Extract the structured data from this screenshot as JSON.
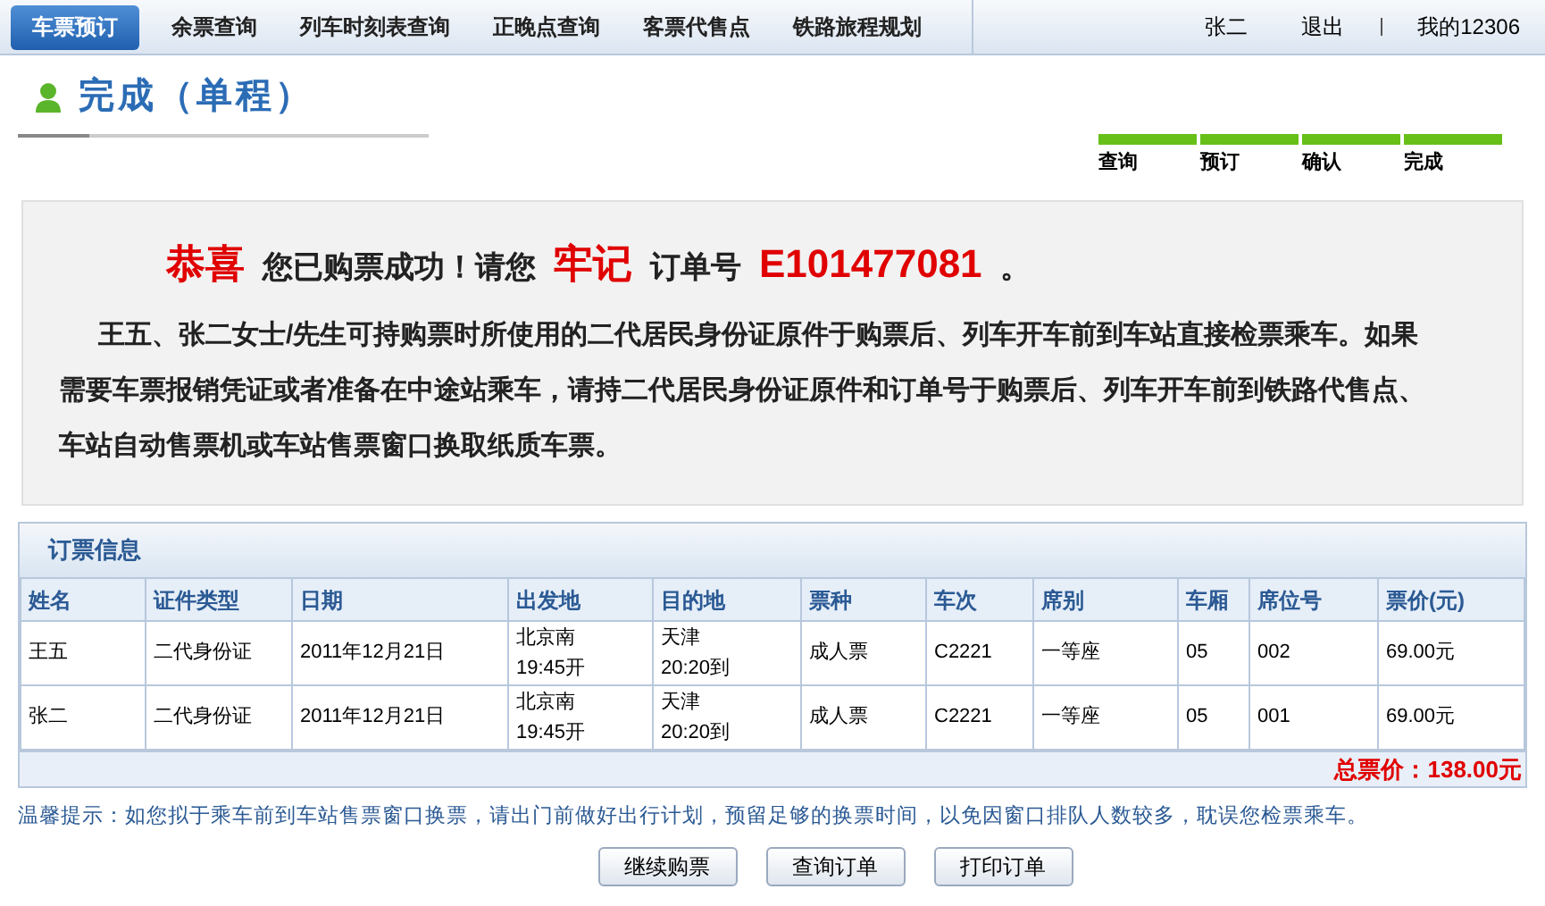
{
  "nav": {
    "tabs": [
      {
        "label": "车票预订",
        "selected": true
      },
      {
        "label": "余票查询",
        "selected": false
      },
      {
        "label": "列车时刻表查询",
        "selected": false
      },
      {
        "label": "正晚点查询",
        "selected": false
      },
      {
        "label": "客票代售点",
        "selected": false
      },
      {
        "label": "铁路旅程规划",
        "selected": false
      }
    ],
    "user": "张二",
    "logout": "退出",
    "account": "我的12306"
  },
  "page_title": "完成（单程）",
  "steps": [
    {
      "label": "查询",
      "done": true
    },
    {
      "label": "预订",
      "done": true
    },
    {
      "label": "确认",
      "done": true
    },
    {
      "label": "完成",
      "done": true
    }
  ],
  "message": {
    "headline": [
      {
        "text": "恭喜",
        "kind": "highlight"
      },
      {
        "text": "您已购票成功！请您",
        "kind": "plain"
      },
      {
        "text": "牢记",
        "kind": "highlight"
      },
      {
        "text": "订单号",
        "kind": "plain"
      },
      {
        "text": "E101477081",
        "kind": "highlight"
      },
      {
        "text": "。",
        "kind": "plain"
      }
    ],
    "body": "王五、张二女士/先生可持购票时所使用的二代居民身份证原件于购票后、列车开车前到车站直接检票乘车。如果需要车票报销凭证或者准备在中途站乘车，请持二代居民身份证原件和订单号于购票后、列车开车前到铁路代售点、车站自动售票机或车站售票窗口换取纸质车票。"
  },
  "order": {
    "title": "订票信息",
    "columns": [
      "姓名",
      "证件类型",
      "日期",
      "出发地",
      "目的地",
      "票种",
      "车次",
      "席别",
      "车厢",
      "席位号",
      "票价(元)"
    ],
    "rows": [
      {
        "cells": [
          "王五",
          "二代身份证",
          "2011年12月21日",
          [
            "北京南",
            "19:45开"
          ],
          [
            "天津",
            "20:20到"
          ],
          "成人票",
          "C2221",
          "一等座",
          "05",
          "002",
          "69.00元"
        ]
      },
      {
        "cells": [
          "张二",
          "二代身份证",
          "2011年12月21日",
          [
            "北京南",
            "19:45开"
          ],
          [
            "天津",
            "20:20到"
          ],
          "成人票",
          "C2221",
          "一等座",
          "05",
          "001",
          "69.00元"
        ]
      }
    ],
    "total": "总票价：138.00元"
  },
  "tip": "温馨提示：如您拟于乘车前到车站售票窗口换票，请出门前做好出行计划，预留足够的换票时间，以免因窗口排队人数较多，耽误您检票乘车。",
  "buttons": [
    "继续购票",
    "查询订单",
    "打印订单"
  ]
}
